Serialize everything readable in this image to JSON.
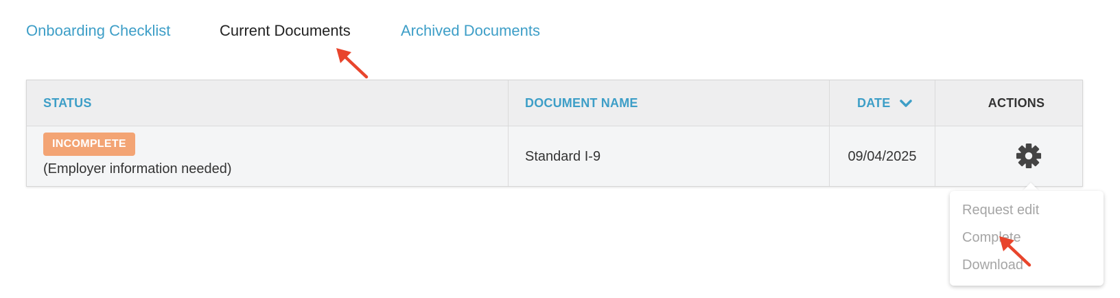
{
  "tabs": {
    "onboarding": "Onboarding Checklist",
    "current": "Current Documents",
    "archived": "Archived Documents"
  },
  "table": {
    "headers": {
      "status": "STATUS",
      "document_name": "DOCUMENT NAME",
      "date": "DATE",
      "actions": "ACTIONS"
    },
    "rows": [
      {
        "status_badge": "INCOMPLETE",
        "status_note": "(Employer information needed)",
        "document_name": "Standard I-9",
        "date": "09/04/2025"
      }
    ]
  },
  "actions_menu": {
    "items": [
      "Request edit",
      "Complete",
      "Download"
    ]
  },
  "colors": {
    "link": "#3d9ec7",
    "badge_incomplete": "#f3a474",
    "annotation_arrow": "#e8452c",
    "menu_item_disabled": "#a5a5a5"
  },
  "icons": {
    "sort": "chevron-down-icon",
    "actions": "gear-icon",
    "annotation": "red-arrow-icon"
  }
}
